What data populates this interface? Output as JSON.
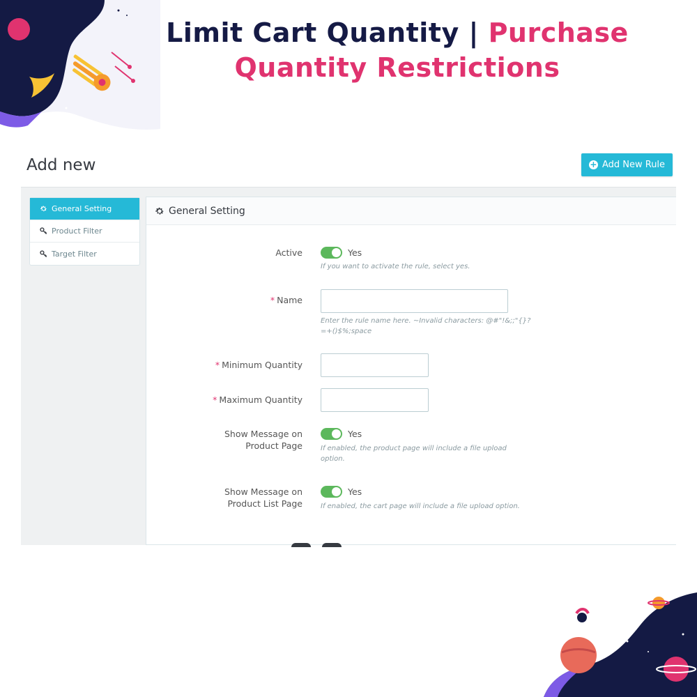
{
  "headline": {
    "part1": "Limit Cart Quantity | ",
    "part2": "Purchase",
    "line2": "Quantity Restrictions"
  },
  "page": {
    "title": "Add new",
    "add_rule_button": "Add New Rule"
  },
  "sidebar": {
    "items": [
      {
        "label": "General Setting",
        "icon": "gear-icon",
        "active": true
      },
      {
        "label": "Product Filter",
        "icon": "key-icon",
        "active": false
      },
      {
        "label": "Target Filter",
        "icon": "key-icon",
        "active": false
      }
    ]
  },
  "panel": {
    "title": "General Setting"
  },
  "form": {
    "active": {
      "label": "Active",
      "value": "Yes",
      "help": "If you want to activate the rule, select yes."
    },
    "name": {
      "label": "Name",
      "value": "",
      "help_line1": "Enter the rule name here. ~Invalid characters: @#\"!&;;\"{}?",
      "help_line2": "=+()$%;space"
    },
    "min_qty": {
      "label": "Minimum Quantity",
      "value": ""
    },
    "max_qty": {
      "label": "Maximum Quantity",
      "value": ""
    },
    "show_product": {
      "label_line1": "Show Message on",
      "label_line2": "Product Page",
      "value": "Yes",
      "help_line1": "If enabled, the product page will include a file upload",
      "help_line2": "option."
    },
    "show_list": {
      "label_line1": "Show Message on",
      "label_line2": "Product List Page",
      "value": "Yes",
      "help": "If enabled, the cart page will include a file upload option."
    }
  },
  "colors": {
    "accent": "#25b9d7",
    "switch_on": "#5cb85c",
    "headline_dark": "#151a45",
    "headline_pink": "#e0336f"
  }
}
